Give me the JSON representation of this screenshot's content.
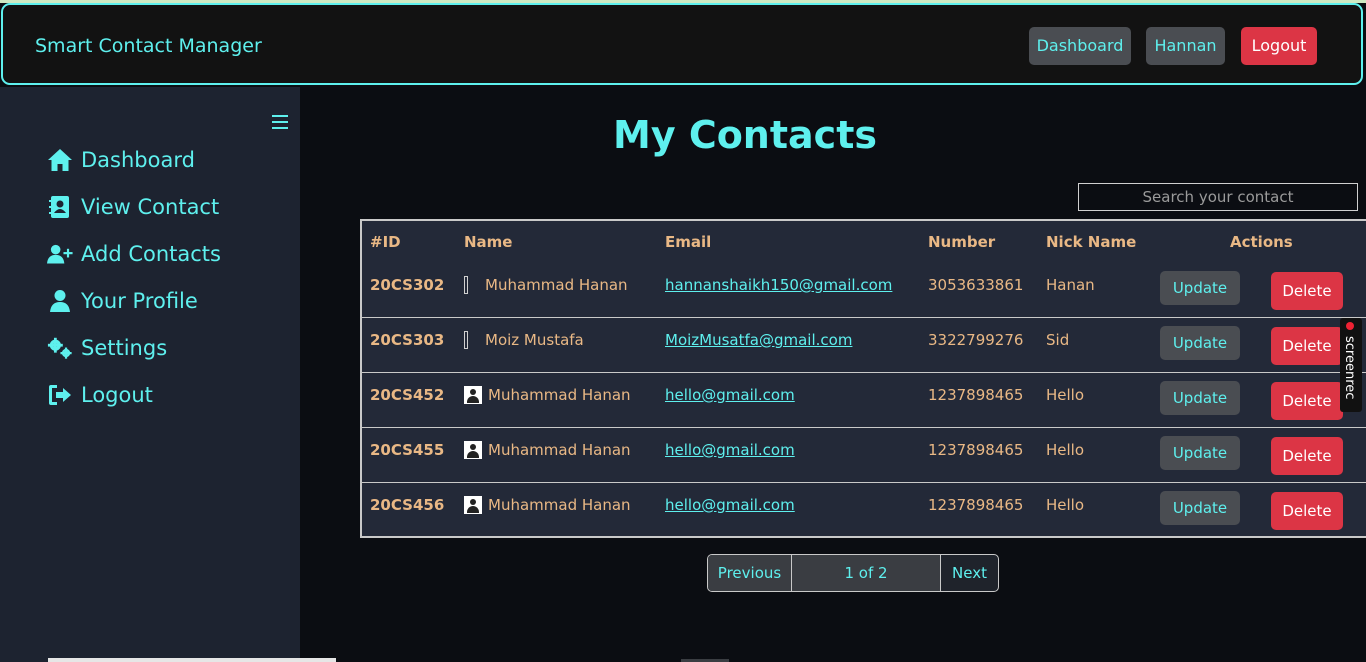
{
  "navbar": {
    "brand": "Smart Contact Manager",
    "dashboard_label": "Dashboard",
    "user_label": "Hannan",
    "logout_label": "Logout"
  },
  "sidebar": {
    "items": [
      {
        "label": "Dashboard",
        "icon": "home-icon"
      },
      {
        "label": "View Contact",
        "icon": "contact-book-icon"
      },
      {
        "label": "Add Contacts",
        "icon": "user-plus-icon"
      },
      {
        "label": "Your Profile",
        "icon": "user-icon"
      },
      {
        "label": "Settings",
        "icon": "gears-icon"
      },
      {
        "label": "Logout",
        "icon": "sign-out-icon"
      }
    ]
  },
  "main": {
    "title": "My Contacts",
    "search_placeholder": "Search your contact"
  },
  "table": {
    "headers": {
      "id": "#ID",
      "name": "Name",
      "email": "Email",
      "number": "Number",
      "nick": "Nick Name",
      "actions": "Actions"
    },
    "update_label": "Update",
    "delete_label": "Delete",
    "rows": [
      {
        "id": "20CS302",
        "name": "Muhammad Hanan",
        "email": "hannanshaikh150@gmail.com",
        "number": "3053633861",
        "nick": "Hanan"
      },
      {
        "id": "20CS303",
        "name": "Moiz Mustafa",
        "email": "MoizMusatfa@gmail.com",
        "number": "3322799276",
        "nick": "Sid"
      },
      {
        "id": "20CS452",
        "name": "Muhammad Hanan",
        "email": "hello@gmail.com",
        "number": "1237898465",
        "nick": "Hello"
      },
      {
        "id": "20CS455",
        "name": "Muhammad Hanan",
        "email": "hello@gmail.com",
        "number": "1237898465",
        "nick": "Hello"
      },
      {
        "id": "20CS456",
        "name": "Muhammad Hanan",
        "email": "hello@gmail.com",
        "number": "1237898465",
        "nick": "Hello"
      }
    ]
  },
  "pagination": {
    "previous_label": "Previous",
    "page_info": "1 of 2",
    "next_label": "Next"
  },
  "recorder": {
    "label": "screenrec"
  },
  "colors": {
    "accent": "#5ef0ee",
    "danger": "#dc3545",
    "secondary": "#4a4d52",
    "table_text": "#e9b885"
  }
}
